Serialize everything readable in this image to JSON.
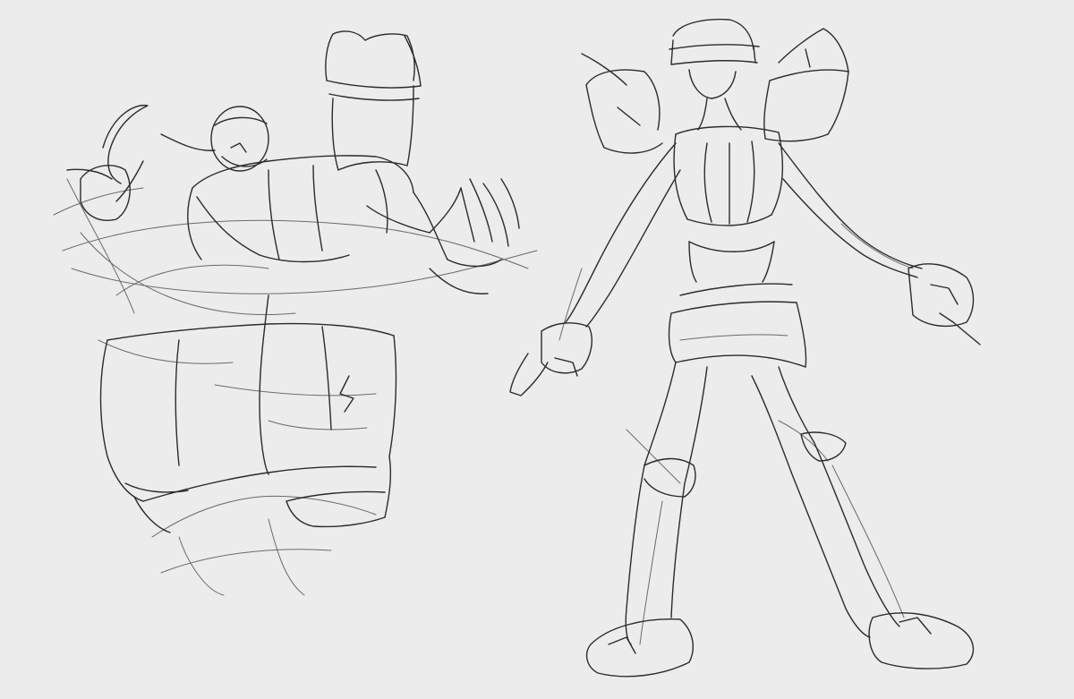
{
  "background_color": "#ececec",
  "ink_color": "#2b2b2b",
  "ink_light_color": "#6a6a6a",
  "figures": [
    {
      "name": "crouching-figure-sketch"
    },
    {
      "name": "standing-figure-sketch"
    }
  ]
}
